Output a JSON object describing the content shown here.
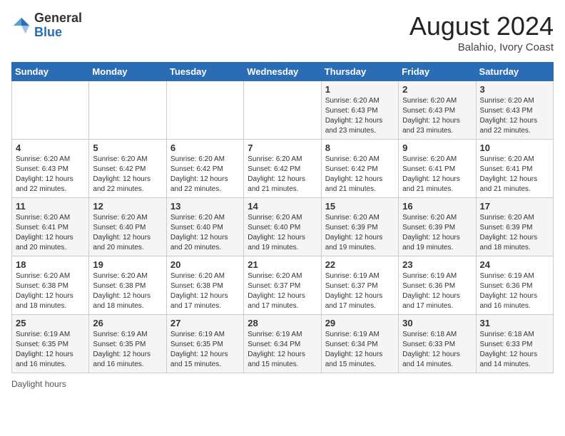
{
  "header": {
    "logo_general": "General",
    "logo_blue": "Blue",
    "month_year": "August 2024",
    "location": "Balahio, Ivory Coast"
  },
  "days_of_week": [
    "Sunday",
    "Monday",
    "Tuesday",
    "Wednesday",
    "Thursday",
    "Friday",
    "Saturday"
  ],
  "footer": {
    "daylight_label": "Daylight hours"
  },
  "weeks": [
    [
      {
        "day": "",
        "info": ""
      },
      {
        "day": "",
        "info": ""
      },
      {
        "day": "",
        "info": ""
      },
      {
        "day": "",
        "info": ""
      },
      {
        "day": "1",
        "info": "Sunrise: 6:20 AM\nSunset: 6:43 PM\nDaylight: 12 hours\nand 23 minutes."
      },
      {
        "day": "2",
        "info": "Sunrise: 6:20 AM\nSunset: 6:43 PM\nDaylight: 12 hours\nand 23 minutes."
      },
      {
        "day": "3",
        "info": "Sunrise: 6:20 AM\nSunset: 6:43 PM\nDaylight: 12 hours\nand 22 minutes."
      }
    ],
    [
      {
        "day": "4",
        "info": "Sunrise: 6:20 AM\nSunset: 6:43 PM\nDaylight: 12 hours\nand 22 minutes."
      },
      {
        "day": "5",
        "info": "Sunrise: 6:20 AM\nSunset: 6:42 PM\nDaylight: 12 hours\nand 22 minutes."
      },
      {
        "day": "6",
        "info": "Sunrise: 6:20 AM\nSunset: 6:42 PM\nDaylight: 12 hours\nand 22 minutes."
      },
      {
        "day": "7",
        "info": "Sunrise: 6:20 AM\nSunset: 6:42 PM\nDaylight: 12 hours\nand 21 minutes."
      },
      {
        "day": "8",
        "info": "Sunrise: 6:20 AM\nSunset: 6:42 PM\nDaylight: 12 hours\nand 21 minutes."
      },
      {
        "day": "9",
        "info": "Sunrise: 6:20 AM\nSunset: 6:41 PM\nDaylight: 12 hours\nand 21 minutes."
      },
      {
        "day": "10",
        "info": "Sunrise: 6:20 AM\nSunset: 6:41 PM\nDaylight: 12 hours\nand 21 minutes."
      }
    ],
    [
      {
        "day": "11",
        "info": "Sunrise: 6:20 AM\nSunset: 6:41 PM\nDaylight: 12 hours\nand 20 minutes."
      },
      {
        "day": "12",
        "info": "Sunrise: 6:20 AM\nSunset: 6:40 PM\nDaylight: 12 hours\nand 20 minutes."
      },
      {
        "day": "13",
        "info": "Sunrise: 6:20 AM\nSunset: 6:40 PM\nDaylight: 12 hours\nand 20 minutes."
      },
      {
        "day": "14",
        "info": "Sunrise: 6:20 AM\nSunset: 6:40 PM\nDaylight: 12 hours\nand 19 minutes."
      },
      {
        "day": "15",
        "info": "Sunrise: 6:20 AM\nSunset: 6:39 PM\nDaylight: 12 hours\nand 19 minutes."
      },
      {
        "day": "16",
        "info": "Sunrise: 6:20 AM\nSunset: 6:39 PM\nDaylight: 12 hours\nand 19 minutes."
      },
      {
        "day": "17",
        "info": "Sunrise: 6:20 AM\nSunset: 6:39 PM\nDaylight: 12 hours\nand 18 minutes."
      }
    ],
    [
      {
        "day": "18",
        "info": "Sunrise: 6:20 AM\nSunset: 6:38 PM\nDaylight: 12 hours\nand 18 minutes."
      },
      {
        "day": "19",
        "info": "Sunrise: 6:20 AM\nSunset: 6:38 PM\nDaylight: 12 hours\nand 18 minutes."
      },
      {
        "day": "20",
        "info": "Sunrise: 6:20 AM\nSunset: 6:38 PM\nDaylight: 12 hours\nand 17 minutes."
      },
      {
        "day": "21",
        "info": "Sunrise: 6:20 AM\nSunset: 6:37 PM\nDaylight: 12 hours\nand 17 minutes."
      },
      {
        "day": "22",
        "info": "Sunrise: 6:19 AM\nSunset: 6:37 PM\nDaylight: 12 hours\nand 17 minutes."
      },
      {
        "day": "23",
        "info": "Sunrise: 6:19 AM\nSunset: 6:36 PM\nDaylight: 12 hours\nand 17 minutes."
      },
      {
        "day": "24",
        "info": "Sunrise: 6:19 AM\nSunset: 6:36 PM\nDaylight: 12 hours\nand 16 minutes."
      }
    ],
    [
      {
        "day": "25",
        "info": "Sunrise: 6:19 AM\nSunset: 6:35 PM\nDaylight: 12 hours\nand 16 minutes."
      },
      {
        "day": "26",
        "info": "Sunrise: 6:19 AM\nSunset: 6:35 PM\nDaylight: 12 hours\nand 16 minutes."
      },
      {
        "day": "27",
        "info": "Sunrise: 6:19 AM\nSunset: 6:35 PM\nDaylight: 12 hours\nand 15 minutes."
      },
      {
        "day": "28",
        "info": "Sunrise: 6:19 AM\nSunset: 6:34 PM\nDaylight: 12 hours\nand 15 minutes."
      },
      {
        "day": "29",
        "info": "Sunrise: 6:19 AM\nSunset: 6:34 PM\nDaylight: 12 hours\nand 15 minutes."
      },
      {
        "day": "30",
        "info": "Sunrise: 6:18 AM\nSunset: 6:33 PM\nDaylight: 12 hours\nand 14 minutes."
      },
      {
        "day": "31",
        "info": "Sunrise: 6:18 AM\nSunset: 6:33 PM\nDaylight: 12 hours\nand 14 minutes."
      }
    ]
  ]
}
